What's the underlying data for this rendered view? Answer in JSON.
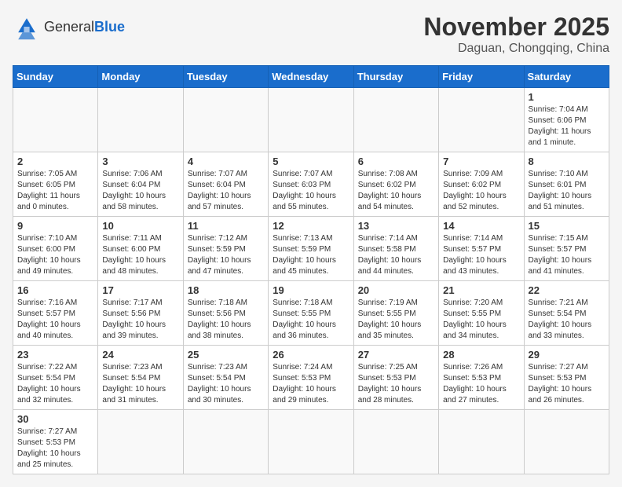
{
  "logo": {
    "text_general": "General",
    "text_blue": "Blue"
  },
  "title": "November 2025",
  "subtitle": "Daguan, Chongqing, China",
  "days_of_week": [
    "Sunday",
    "Monday",
    "Tuesday",
    "Wednesday",
    "Thursday",
    "Friday",
    "Saturday"
  ],
  "weeks": [
    [
      {
        "day": "",
        "info": ""
      },
      {
        "day": "",
        "info": ""
      },
      {
        "day": "",
        "info": ""
      },
      {
        "day": "",
        "info": ""
      },
      {
        "day": "",
        "info": ""
      },
      {
        "day": "",
        "info": ""
      },
      {
        "day": "1",
        "info": "Sunrise: 7:04 AM\nSunset: 6:06 PM\nDaylight: 11 hours and 1 minute."
      }
    ],
    [
      {
        "day": "2",
        "info": "Sunrise: 7:05 AM\nSunset: 6:05 PM\nDaylight: 11 hours and 0 minutes."
      },
      {
        "day": "3",
        "info": "Sunrise: 7:06 AM\nSunset: 6:04 PM\nDaylight: 10 hours and 58 minutes."
      },
      {
        "day": "4",
        "info": "Sunrise: 7:07 AM\nSunset: 6:04 PM\nDaylight: 10 hours and 57 minutes."
      },
      {
        "day": "5",
        "info": "Sunrise: 7:07 AM\nSunset: 6:03 PM\nDaylight: 10 hours and 55 minutes."
      },
      {
        "day": "6",
        "info": "Sunrise: 7:08 AM\nSunset: 6:02 PM\nDaylight: 10 hours and 54 minutes."
      },
      {
        "day": "7",
        "info": "Sunrise: 7:09 AM\nSunset: 6:02 PM\nDaylight: 10 hours and 52 minutes."
      },
      {
        "day": "8",
        "info": "Sunrise: 7:10 AM\nSunset: 6:01 PM\nDaylight: 10 hours and 51 minutes."
      }
    ],
    [
      {
        "day": "9",
        "info": "Sunrise: 7:10 AM\nSunset: 6:00 PM\nDaylight: 10 hours and 49 minutes."
      },
      {
        "day": "10",
        "info": "Sunrise: 7:11 AM\nSunset: 6:00 PM\nDaylight: 10 hours and 48 minutes."
      },
      {
        "day": "11",
        "info": "Sunrise: 7:12 AM\nSunset: 5:59 PM\nDaylight: 10 hours and 47 minutes."
      },
      {
        "day": "12",
        "info": "Sunrise: 7:13 AM\nSunset: 5:59 PM\nDaylight: 10 hours and 45 minutes."
      },
      {
        "day": "13",
        "info": "Sunrise: 7:14 AM\nSunset: 5:58 PM\nDaylight: 10 hours and 44 minutes."
      },
      {
        "day": "14",
        "info": "Sunrise: 7:14 AM\nSunset: 5:57 PM\nDaylight: 10 hours and 43 minutes."
      },
      {
        "day": "15",
        "info": "Sunrise: 7:15 AM\nSunset: 5:57 PM\nDaylight: 10 hours and 41 minutes."
      }
    ],
    [
      {
        "day": "16",
        "info": "Sunrise: 7:16 AM\nSunset: 5:57 PM\nDaylight: 10 hours and 40 minutes."
      },
      {
        "day": "17",
        "info": "Sunrise: 7:17 AM\nSunset: 5:56 PM\nDaylight: 10 hours and 39 minutes."
      },
      {
        "day": "18",
        "info": "Sunrise: 7:18 AM\nSunset: 5:56 PM\nDaylight: 10 hours and 38 minutes."
      },
      {
        "day": "19",
        "info": "Sunrise: 7:18 AM\nSunset: 5:55 PM\nDaylight: 10 hours and 36 minutes."
      },
      {
        "day": "20",
        "info": "Sunrise: 7:19 AM\nSunset: 5:55 PM\nDaylight: 10 hours and 35 minutes."
      },
      {
        "day": "21",
        "info": "Sunrise: 7:20 AM\nSunset: 5:55 PM\nDaylight: 10 hours and 34 minutes."
      },
      {
        "day": "22",
        "info": "Sunrise: 7:21 AM\nSunset: 5:54 PM\nDaylight: 10 hours and 33 minutes."
      }
    ],
    [
      {
        "day": "23",
        "info": "Sunrise: 7:22 AM\nSunset: 5:54 PM\nDaylight: 10 hours and 32 minutes."
      },
      {
        "day": "24",
        "info": "Sunrise: 7:23 AM\nSunset: 5:54 PM\nDaylight: 10 hours and 31 minutes."
      },
      {
        "day": "25",
        "info": "Sunrise: 7:23 AM\nSunset: 5:54 PM\nDaylight: 10 hours and 30 minutes."
      },
      {
        "day": "26",
        "info": "Sunrise: 7:24 AM\nSunset: 5:53 PM\nDaylight: 10 hours and 29 minutes."
      },
      {
        "day": "27",
        "info": "Sunrise: 7:25 AM\nSunset: 5:53 PM\nDaylight: 10 hours and 28 minutes."
      },
      {
        "day": "28",
        "info": "Sunrise: 7:26 AM\nSunset: 5:53 PM\nDaylight: 10 hours and 27 minutes."
      },
      {
        "day": "29",
        "info": "Sunrise: 7:27 AM\nSunset: 5:53 PM\nDaylight: 10 hours and 26 minutes."
      }
    ],
    [
      {
        "day": "30",
        "info": "Sunrise: 7:27 AM\nSunset: 5:53 PM\nDaylight: 10 hours and 25 minutes."
      },
      {
        "day": "",
        "info": ""
      },
      {
        "day": "",
        "info": ""
      },
      {
        "day": "",
        "info": ""
      },
      {
        "day": "",
        "info": ""
      },
      {
        "day": "",
        "info": ""
      },
      {
        "day": "",
        "info": ""
      }
    ]
  ]
}
